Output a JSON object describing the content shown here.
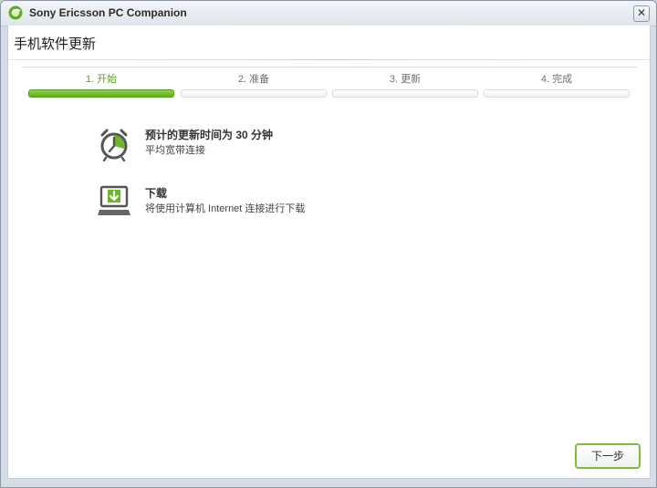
{
  "window": {
    "title": "Sony Ericsson PC Companion",
    "close_symbol": "✕"
  },
  "dialog": {
    "title": "手机软件更新"
  },
  "steps": [
    {
      "label": "1. 开始",
      "active": true
    },
    {
      "label": "2. 准备",
      "active": false
    },
    {
      "label": "3. 更新",
      "active": false
    },
    {
      "label": "4. 完成",
      "active": false
    }
  ],
  "info": {
    "time": {
      "icon": "alarm-clock-icon",
      "heading": "预计的更新时间为  30  分钟",
      "subtitle": "平均宽带连接"
    },
    "download": {
      "icon": "laptop-download-icon",
      "heading": "下载",
      "subtitle": "将使用计算机 Internet 连接进行下载"
    }
  },
  "buttons": {
    "next": "下一步"
  },
  "colors": {
    "accent": "#6ab82a",
    "accent_dark": "#5a9f1f"
  }
}
